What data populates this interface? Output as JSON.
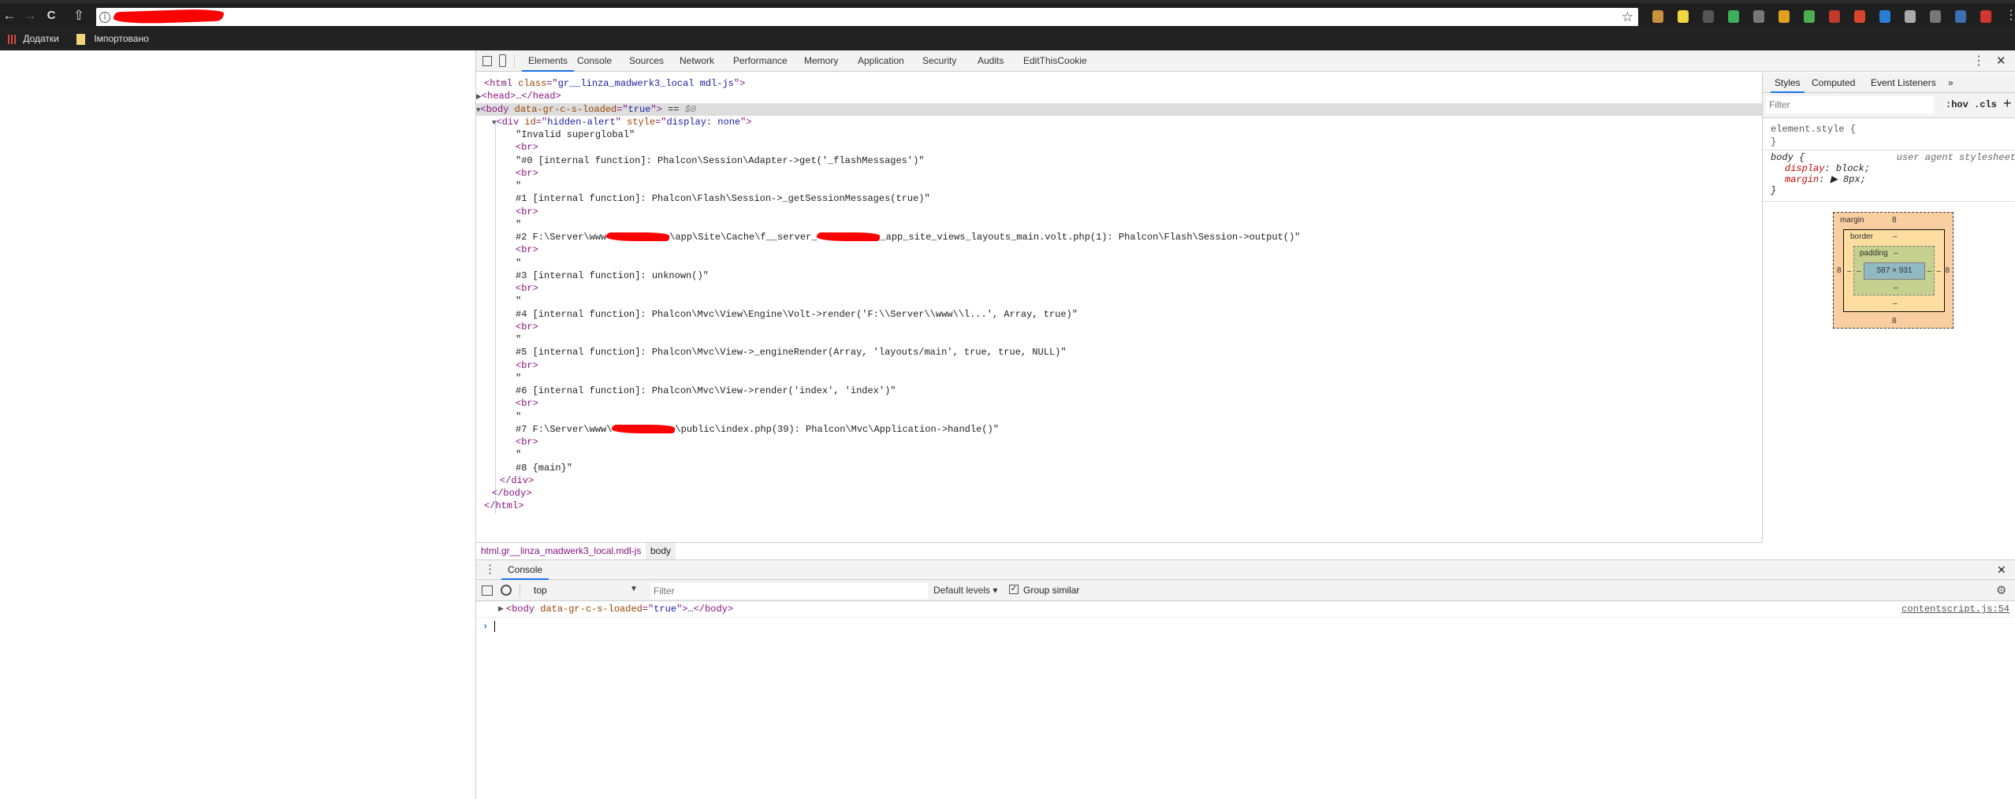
{
  "browser": {
    "nav": {
      "back": "←",
      "forward": "→",
      "reload": "C",
      "home": "⇧"
    },
    "address_info_icon": "i",
    "bookmark_star": "☆",
    "extensions": [
      {
        "name": "cookie-extension-icon",
        "color": "#c8903f"
      },
      {
        "name": "notes-extension-icon",
        "color": "#f0d640"
      },
      {
        "name": "lock-extension-icon",
        "color": "#555555"
      },
      {
        "name": "grammarly-extension-icon",
        "color": "#3dae5a"
      },
      {
        "name": "mail-extension-icon",
        "color": "#777777"
      },
      {
        "name": "apps-extension-icon",
        "color": "#e0a020"
      },
      {
        "name": "shield-extension-icon",
        "color": "#4caf50"
      },
      {
        "name": "dashboard-extension-icon",
        "color": "#c0392b"
      },
      {
        "name": "wand-extension-icon",
        "color": "#d9442a"
      },
      {
        "name": "circle-extension-icon",
        "color": "#2a7fd4"
      },
      {
        "name": "gear-extension-icon",
        "color": "#aaaaaa"
      },
      {
        "name": "download-extension-icon",
        "color": "#777777"
      },
      {
        "name": "e-extension-icon",
        "color": "#3a6fb0"
      },
      {
        "name": "yandex-extension-icon",
        "color": "#d3362e"
      }
    ],
    "bookmarks": [
      {
        "label": "Додатки",
        "icon": "apps-icon"
      },
      {
        "label": "Імпортовано",
        "icon": "folder-icon"
      }
    ]
  },
  "devtools": {
    "tabs": [
      "Elements",
      "Console",
      "Sources",
      "Network",
      "Performance",
      "Memory",
      "Application",
      "Security",
      "Audits",
      "EditThisCookie"
    ],
    "active_tab": "Elements",
    "dom_lines": [
      {
        "depth": 0,
        "seg": [
          {
            "k": "tag",
            "t": "<html "
          },
          {
            "k": "attr",
            "t": "class"
          },
          {
            "k": "tag",
            "t": "=\""
          },
          {
            "k": "val",
            "t": "gr__linza_madwerk3_local mdl-js"
          },
          {
            "k": "tag",
            "t": "\">"
          }
        ]
      },
      {
        "depth": 0,
        "seg": [
          {
            "k": "arrow",
            "t": "▶"
          },
          {
            "k": "tag",
            "t": "<head>"
          },
          {
            "k": "txt",
            "t": "…"
          },
          {
            "k": "tag",
            "t": "</head>"
          }
        ]
      },
      {
        "depth": 0,
        "selected": true,
        "seg": [
          {
            "k": "arrow",
            "t": "▼"
          },
          {
            "k": "tag",
            "t": "<body "
          },
          {
            "k": "attr",
            "t": "data-gr-c-s-loaded"
          },
          {
            "k": "tag",
            "t": "=\""
          },
          {
            "k": "val",
            "t": "true"
          },
          {
            "k": "tag",
            "t": "\">"
          },
          {
            "k": "txt",
            "t": " == "
          },
          {
            "k": "cmt",
            "t": "$0"
          }
        ]
      },
      {
        "depth": 1,
        "seg": [
          {
            "k": "arrow",
            "t": "▼"
          },
          {
            "k": "tag",
            "t": "<div "
          },
          {
            "k": "attr",
            "t": "id"
          },
          {
            "k": "tag",
            "t": "=\""
          },
          {
            "k": "val",
            "t": "hidden-alert"
          },
          {
            "k": "tag",
            "t": "\" "
          },
          {
            "k": "attr",
            "t": "style"
          },
          {
            "k": "tag",
            "t": "=\""
          },
          {
            "k": "val",
            "t": "display: none"
          },
          {
            "k": "tag",
            "t": "\">"
          }
        ]
      },
      {
        "depth": 2,
        "seg": [
          {
            "k": "txt",
            "t": "\"Invalid superglobal\""
          }
        ]
      },
      {
        "depth": 2,
        "seg": [
          {
            "k": "tag",
            "t": "<br>"
          }
        ]
      },
      {
        "depth": 2,
        "seg": [
          {
            "k": "txt",
            "t": "\"#0 [internal function]: Phalcon\\Session\\Adapter->get('_flashMessages')\""
          }
        ]
      },
      {
        "depth": 2,
        "seg": [
          {
            "k": "tag",
            "t": "<br>"
          }
        ]
      },
      {
        "depth": 2,
        "seg": [
          {
            "k": "txt",
            "t": "\""
          }
        ]
      },
      {
        "depth": 2,
        "seg": [
          {
            "k": "txt",
            "t": "#1 [internal function]: Phalcon\\Flash\\Session->_getSessionMessages(true)\""
          }
        ]
      },
      {
        "depth": 2,
        "seg": [
          {
            "k": "tag",
            "t": "<br>"
          }
        ]
      },
      {
        "depth": 2,
        "seg": [
          {
            "k": "txt",
            "t": "\""
          }
        ]
      },
      {
        "depth": 2,
        "seg": [
          {
            "k": "txt",
            "t": "#2 F:\\Server\\www"
          },
          {
            "k": "redacted",
            "t": ""
          },
          {
            "k": "txt",
            "t": "\\app\\Site\\Cache\\f__server_"
          },
          {
            "k": "redacted",
            "t": ""
          },
          {
            "k": "txt",
            "t": "_app_site_views_layouts_main.volt.php(1): Phalcon\\Flash\\Session->output()\""
          }
        ]
      },
      {
        "depth": 2,
        "seg": [
          {
            "k": "tag",
            "t": "<br>"
          }
        ]
      },
      {
        "depth": 2,
        "seg": [
          {
            "k": "txt",
            "t": "\""
          }
        ]
      },
      {
        "depth": 2,
        "seg": [
          {
            "k": "txt",
            "t": "#3 [internal function]: unknown()\""
          }
        ]
      },
      {
        "depth": 2,
        "seg": [
          {
            "k": "tag",
            "t": "<br>"
          }
        ]
      },
      {
        "depth": 2,
        "seg": [
          {
            "k": "txt",
            "t": "\""
          }
        ]
      },
      {
        "depth": 2,
        "seg": [
          {
            "k": "txt",
            "t": "#4 [internal function]: Phalcon\\Mvc\\View\\Engine\\Volt->render('F:\\\\Server\\\\www\\\\l...', Array, true)\""
          }
        ]
      },
      {
        "depth": 2,
        "seg": [
          {
            "k": "tag",
            "t": "<br>"
          }
        ]
      },
      {
        "depth": 2,
        "seg": [
          {
            "k": "txt",
            "t": "\""
          }
        ]
      },
      {
        "depth": 2,
        "seg": [
          {
            "k": "txt",
            "t": "#5 [internal function]: Phalcon\\Mvc\\View->_engineRender(Array, 'layouts/main', true, true, NULL)\""
          }
        ]
      },
      {
        "depth": 2,
        "seg": [
          {
            "k": "tag",
            "t": "<br>"
          }
        ]
      },
      {
        "depth": 2,
        "seg": [
          {
            "k": "txt",
            "t": "\""
          }
        ]
      },
      {
        "depth": 2,
        "seg": [
          {
            "k": "txt",
            "t": "#6 [internal function]: Phalcon\\Mvc\\View->render('index', 'index')\""
          }
        ]
      },
      {
        "depth": 2,
        "seg": [
          {
            "k": "tag",
            "t": "<br>"
          }
        ]
      },
      {
        "depth": 2,
        "seg": [
          {
            "k": "txt",
            "t": "\""
          }
        ]
      },
      {
        "depth": 2,
        "seg": [
          {
            "k": "txt",
            "t": "#7 F:\\Server\\www\\"
          },
          {
            "k": "redacted",
            "t": ""
          },
          {
            "k": "txt",
            "t": "\\public\\index.php(39): Phalcon\\Mvc\\Application->handle()\""
          }
        ]
      },
      {
        "depth": 2,
        "seg": [
          {
            "k": "tag",
            "t": "<br>"
          }
        ]
      },
      {
        "depth": 2,
        "seg": [
          {
            "k": "txt",
            "t": "\""
          }
        ]
      },
      {
        "depth": 2,
        "seg": [
          {
            "k": "txt",
            "t": "#8 {main}\""
          }
        ]
      },
      {
        "depth": 1,
        "seg": [
          {
            "k": "tag",
            "t": "</div>"
          }
        ]
      },
      {
        "depth": 0.5,
        "seg": [
          {
            "k": "tag",
            "t": "</body>"
          }
        ]
      },
      {
        "depth": 0,
        "seg": [
          {
            "k": "tag",
            "t": "</html>"
          }
        ]
      }
    ],
    "breadcrumbs": [
      "html.gr__linza_madwerk3_local.mdl-js",
      "body"
    ],
    "sidebar": {
      "tabs": [
        "Styles",
        "Computed",
        "Event Listeners",
        "»"
      ],
      "filter_placeholder": "Filter",
      "hov": ":hov",
      "cls": ".cls",
      "add": "+",
      "element_style": "element.style {",
      "close_brace": "}",
      "body_selector": "body {",
      "ua_label": "user agent stylesheet",
      "props": [
        {
          "name": "display",
          "value": "block;"
        },
        {
          "name": "margin",
          "value": "▶ 8px;"
        }
      ],
      "box_model": {
        "margin_label": "margin",
        "border_label": "border",
        "padding_label": "padding",
        "margin": {
          "top": "8",
          "right": "8",
          "bottom": "8",
          "left": "8"
        },
        "border": {
          "top": "–",
          "right": "–",
          "bottom": "–",
          "left": "–"
        },
        "padding": {
          "top": "–",
          "right": "–",
          "bottom": "–",
          "left": "–"
        },
        "content": "587 × 931"
      }
    },
    "drawer": {
      "tab": "Console",
      "context": "top",
      "filter_placeholder": "Filter",
      "levels": "Default levels ▾",
      "group_similar": "Group similar",
      "group_similar_checked": true,
      "message": {
        "seg": [
          {
            "k": "tag",
            "t": "<body "
          },
          {
            "k": "attr",
            "t": "data-gr-c-s-loaded"
          },
          {
            "k": "tag",
            "t": "=\""
          },
          {
            "k": "val",
            "t": "true"
          },
          {
            "k": "tag",
            "t": "\">"
          },
          {
            "k": "txt",
            "t": "…"
          },
          {
            "k": "tag",
            "t": "</body>"
          }
        ]
      },
      "source_link": "contentscript.js:54",
      "prompt": "›"
    }
  }
}
